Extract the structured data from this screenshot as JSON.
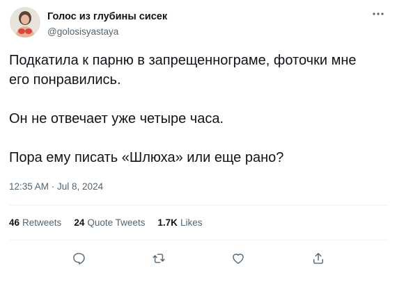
{
  "author": {
    "display_name": "Голос из глубины сисек",
    "handle": "@golosisyastaya"
  },
  "tweet": {
    "paragraphs": [
      "Подкатила к парню в запрещеннограме, фоточки мне его понравились.",
      "Он не отвечает уже четыре часа.",
      "Пора ему писать «Шлюха» или еще рано?"
    ],
    "timestamp": "12:35 AM · Jul 8, 2024"
  },
  "stats": {
    "retweets_count": "46",
    "retweets_label": "Retweets",
    "quote_count": "24",
    "quote_label": "Quote Tweets",
    "likes_count": "1.7K",
    "likes_label": "Likes"
  },
  "actions": [
    "reply-icon",
    "retweet-icon",
    "like-icon",
    "share-icon"
  ],
  "colors": {
    "text": "#0f1419",
    "secondary": "#536471",
    "divider": "#eff3f4"
  }
}
